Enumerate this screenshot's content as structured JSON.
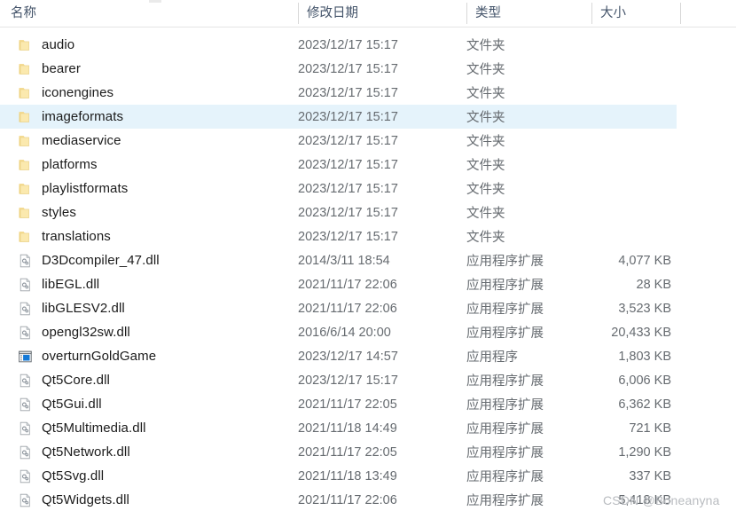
{
  "header": {
    "columns": [
      {
        "label": "名称",
        "name": "column-header-name"
      },
      {
        "label": "修改日期",
        "name": "column-header-date-modified"
      },
      {
        "label": "类型",
        "name": "column-header-type"
      },
      {
        "label": "大小",
        "name": "column-header-size"
      }
    ]
  },
  "colors": {
    "selection": "#e5f3fb",
    "header_text": "#44546a",
    "folder_icon": "#f7dc8f",
    "row_text": "#1b1b1b",
    "meta_text": "#666b70"
  },
  "rows": [
    {
      "name": "audio",
      "icon": "folder-icon",
      "date": "2023/12/17 15:17",
      "type": "文件夹",
      "size": "",
      "selected": false
    },
    {
      "name": "bearer",
      "icon": "folder-icon",
      "date": "2023/12/17 15:17",
      "type": "文件夹",
      "size": "",
      "selected": false
    },
    {
      "name": "iconengines",
      "icon": "folder-icon",
      "date": "2023/12/17 15:17",
      "type": "文件夹",
      "size": "",
      "selected": false
    },
    {
      "name": "imageformats",
      "icon": "folder-icon",
      "date": "2023/12/17 15:17",
      "type": "文件夹",
      "size": "",
      "selected": true
    },
    {
      "name": "mediaservice",
      "icon": "folder-icon",
      "date": "2023/12/17 15:17",
      "type": "文件夹",
      "size": "",
      "selected": false
    },
    {
      "name": "platforms",
      "icon": "folder-icon",
      "date": "2023/12/17 15:17",
      "type": "文件夹",
      "size": "",
      "selected": false
    },
    {
      "name": "playlistformats",
      "icon": "folder-icon",
      "date": "2023/12/17 15:17",
      "type": "文件夹",
      "size": "",
      "selected": false
    },
    {
      "name": "styles",
      "icon": "folder-icon",
      "date": "2023/12/17 15:17",
      "type": "文件夹",
      "size": "",
      "selected": false
    },
    {
      "name": "translations",
      "icon": "folder-icon",
      "date": "2023/12/17 15:17",
      "type": "文件夹",
      "size": "",
      "selected": false
    },
    {
      "name": "D3Dcompiler_47.dll",
      "icon": "dll-file-icon",
      "date": "2014/3/11 18:54",
      "type": "应用程序扩展",
      "size": "4,077 KB",
      "selected": false
    },
    {
      "name": "libEGL.dll",
      "icon": "dll-file-icon",
      "date": "2021/11/17 22:06",
      "type": "应用程序扩展",
      "size": "28 KB",
      "selected": false
    },
    {
      "name": "libGLESV2.dll",
      "icon": "dll-file-icon",
      "date": "2021/11/17 22:06",
      "type": "应用程序扩展",
      "size": "3,523 KB",
      "selected": false
    },
    {
      "name": "opengl32sw.dll",
      "icon": "dll-file-icon",
      "date": "2016/6/14 20:00",
      "type": "应用程序扩展",
      "size": "20,433 KB",
      "selected": false
    },
    {
      "name": "overturnGoldGame",
      "icon": "application-exe-icon",
      "date": "2023/12/17 14:57",
      "type": "应用程序",
      "size": "1,803 KB",
      "selected": false
    },
    {
      "name": "Qt5Core.dll",
      "icon": "dll-file-icon",
      "date": "2023/12/17 15:17",
      "type": "应用程序扩展",
      "size": "6,006 KB",
      "selected": false
    },
    {
      "name": "Qt5Gui.dll",
      "icon": "dll-file-icon",
      "date": "2021/11/17 22:05",
      "type": "应用程序扩展",
      "size": "6,362 KB",
      "selected": false
    },
    {
      "name": "Qt5Multimedia.dll",
      "icon": "dll-file-icon",
      "date": "2021/11/18 14:49",
      "type": "应用程序扩展",
      "size": "721 KB",
      "selected": false
    },
    {
      "name": "Qt5Network.dll",
      "icon": "dll-file-icon",
      "date": "2021/11/17 22:05",
      "type": "应用程序扩展",
      "size": "1,290 KB",
      "selected": false
    },
    {
      "name": "Qt5Svg.dll",
      "icon": "dll-file-icon",
      "date": "2021/11/18 13:49",
      "type": "应用程序扩展",
      "size": "337 KB",
      "selected": false
    },
    {
      "name": "Qt5Widgets.dll",
      "icon": "dll-file-icon",
      "date": "2021/11/17 22:06",
      "type": "应用程序扩展",
      "size": "5,418 KB",
      "selected": false
    }
  ],
  "watermark": {
    "text": "CSDN @Boneanyna"
  }
}
